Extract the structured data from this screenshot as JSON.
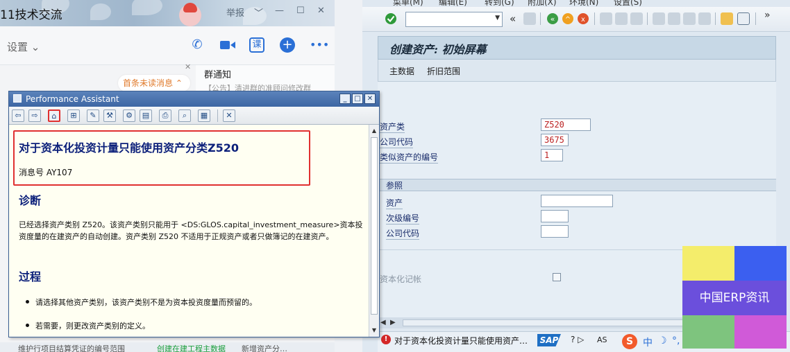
{
  "chat": {
    "title": "11技术交流",
    "window_controls": [
      "举报",
      "﹀",
      "—",
      "☐",
      "✕"
    ],
    "settings_label": "设置",
    "toolbar_icons": [
      "phone-icon",
      "video-icon",
      "class-icon",
      "add-icon",
      "more-icon"
    ],
    "class_label": "课",
    "unread_label": "首条未读消息",
    "notice_title": "群通知",
    "notice_text": "【公告】清进群的准顾问修改群",
    "bottom_tabs": [
      "维护行项目结算凭证的编号范围",
      "创建在建工程主数据",
      "新增资产分…"
    ]
  },
  "sap": {
    "menu": [
      "菜单(M)",
      "编辑(E)",
      "转到(G)",
      "附加(X)",
      "环境(N)",
      "设置(S)"
    ],
    "screen_title": "创建资产: 初始屏幕",
    "tabs": [
      "主数据",
      "折旧范围"
    ],
    "fields": {
      "asset_class": {
        "label": "资产类",
        "value": "Z520"
      },
      "company_code": {
        "label": "公司代码",
        "value": "3675"
      },
      "similar_count": {
        "label": "类似资产的编号",
        "value": "1"
      }
    },
    "reference": {
      "header": "参照",
      "asset_label": "资产",
      "sub_number_label": "次级编号",
      "company_code_label": "公司代码"
    },
    "capitalization_label": "资本化记帐",
    "status_message": "对于资本化投资计量只能使用资产…",
    "status_logo": "SAP",
    "status_help": "? ▷",
    "status_system": "AS",
    "ime": {
      "logo": "S",
      "lang": "中",
      "moon": "☽",
      "punct": "°,"
    }
  },
  "watermark": {
    "text": "中国ERP资讯",
    "colors": [
      "#f4ed6b",
      "#3b5ff0",
      "#6b4fdc",
      "#7ec47e",
      "#d05ad8"
    ]
  },
  "performance_assistant": {
    "title": "Performance Assistant",
    "heading": "对于资本化投资计量只能使用资产分类Z520",
    "message_number": "消息号 AY107",
    "diagnosis_heading": "诊断",
    "diagnosis_text": "已经选择资产类别 Z520。该资产类别只能用于 <DS:GLOS.capital_investment_measure>资本投资度量的在建资产的自动创建。资产类别 Z520 不适用于正规资产或者只做簿记的在建资产。",
    "procedure_heading": "过程",
    "procedure_items": [
      "请选择其他资产类别，该资产类别不是为资本投资度量而预留的。",
      "若需要，则更改资产类别的定义。"
    ]
  }
}
